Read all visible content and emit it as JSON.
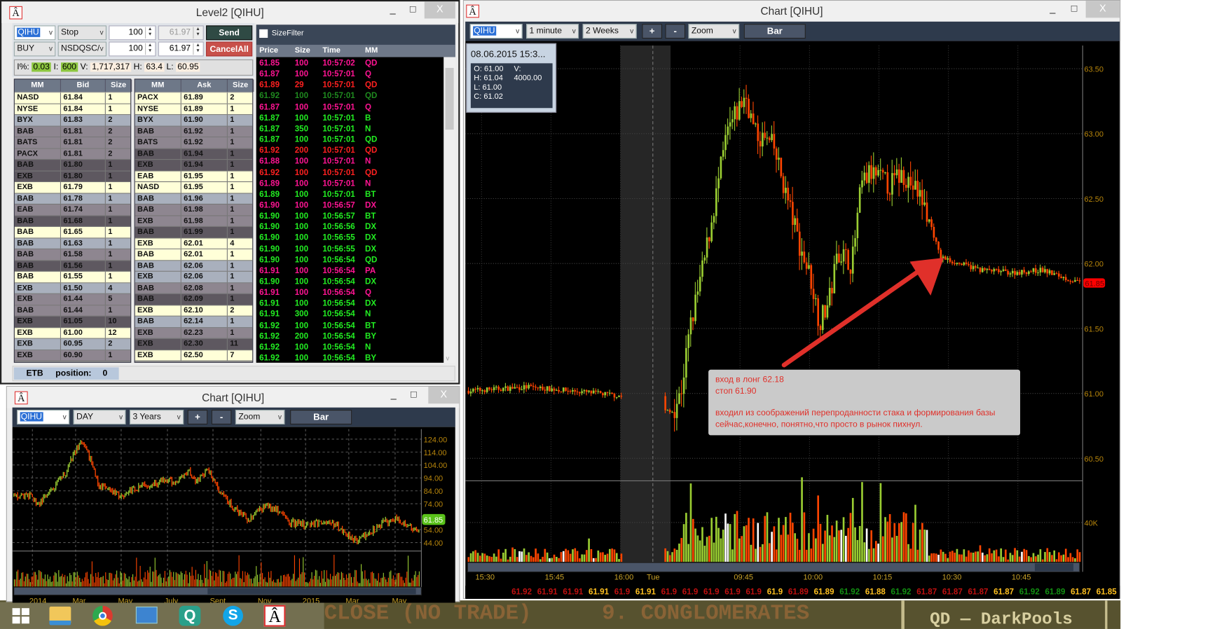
{
  "level2": {
    "title": "Level2 [QIHU]",
    "symbol": "QIHU",
    "order_type": "Stop",
    "side": "BUY",
    "route": "NSDQSC/",
    "qty1": "100",
    "qty2": "100",
    "price1": "61.97",
    "price2": "61.97",
    "send_label": "Send",
    "cancel_all_label": "CancelAll",
    "stats": {
      "i_pct_label": "I%:",
      "i_pct": "0.03",
      "i_label": "I:",
      "i": "600",
      "v_label": "V:",
      "v": "1,717,317",
      "h_label": "H:",
      "h": "63.4",
      "l_label": "L:",
      "l": "60.95"
    },
    "bid_headers": [
      "MM",
      "Bid",
      "Size"
    ],
    "ask_headers": [
      "MM",
      "Ask",
      "Size"
    ],
    "bids": [
      [
        "NASD",
        "61.84",
        "1",
        "y"
      ],
      [
        "NYSE",
        "61.84",
        "1",
        "y"
      ],
      [
        "BYX",
        "61.83",
        "2",
        "b"
      ],
      [
        "BAB",
        "61.81",
        "2",
        "m"
      ],
      [
        "BATS",
        "61.81",
        "2",
        "m"
      ],
      [
        "PACX",
        "61.81",
        "2",
        "m"
      ],
      [
        "BAB",
        "61.80",
        "1",
        "d"
      ],
      [
        "EXB",
        "61.80",
        "1",
        "d"
      ],
      [
        "EXB",
        "61.79",
        "1",
        "y"
      ],
      [
        "BAB",
        "61.78",
        "1",
        "b"
      ],
      [
        "EAB",
        "61.74",
        "1",
        "m"
      ],
      [
        "BAB",
        "61.68",
        "1",
        "d"
      ],
      [
        "BAB",
        "61.65",
        "1",
        "y"
      ],
      [
        "BAB",
        "61.63",
        "1",
        "b"
      ],
      [
        "BAB",
        "61.58",
        "1",
        "m"
      ],
      [
        "BAB",
        "61.56",
        "1",
        "d"
      ],
      [
        "BAB",
        "61.55",
        "1",
        "y"
      ],
      [
        "EXB",
        "61.50",
        "4",
        "b"
      ],
      [
        "EXB",
        "61.44",
        "5",
        "m"
      ],
      [
        "BAB",
        "61.44",
        "1",
        "m"
      ],
      [
        "EXB",
        "61.05",
        "10",
        "d"
      ],
      [
        "EXB",
        "61.00",
        "12",
        "y"
      ],
      [
        "EXB",
        "60.95",
        "2",
        "b"
      ],
      [
        "EXB",
        "60.90",
        "1",
        "m"
      ]
    ],
    "asks": [
      [
        "PACX",
        "61.89",
        "2",
        "y"
      ],
      [
        "NYSE",
        "61.89",
        "1",
        "y"
      ],
      [
        "BYX",
        "61.90",
        "1",
        "b"
      ],
      [
        "BAB",
        "61.92",
        "1",
        "m"
      ],
      [
        "BATS",
        "61.92",
        "1",
        "m"
      ],
      [
        "BAB",
        "61.94",
        "1",
        "d"
      ],
      [
        "EXB",
        "61.94",
        "1",
        "d"
      ],
      [
        "EAB",
        "61.95",
        "1",
        "y"
      ],
      [
        "NASD",
        "61.95",
        "1",
        "y"
      ],
      [
        "BAB",
        "61.96",
        "1",
        "b"
      ],
      [
        "BAB",
        "61.98",
        "1",
        "m"
      ],
      [
        "EXB",
        "61.98",
        "1",
        "m"
      ],
      [
        "BAB",
        "61.99",
        "1",
        "d"
      ],
      [
        "EXB",
        "62.01",
        "4",
        "y"
      ],
      [
        "BAB",
        "62.01",
        "1",
        "y"
      ],
      [
        "BAB",
        "62.06",
        "1",
        "b"
      ],
      [
        "EXB",
        "62.06",
        "1",
        "b"
      ],
      [
        "BAB",
        "62.08",
        "1",
        "m"
      ],
      [
        "BAB",
        "62.09",
        "1",
        "d"
      ],
      [
        "EXB",
        "62.10",
        "2",
        "y"
      ],
      [
        "BAB",
        "62.14",
        "1",
        "b"
      ],
      [
        "EXB",
        "62.23",
        "1",
        "m"
      ],
      [
        "EXB",
        "62.30",
        "11",
        "d"
      ],
      [
        "EXB",
        "62.50",
        "7",
        "y"
      ]
    ],
    "size_filter_label": "SizeFilter",
    "ts_headers": [
      "Price",
      "Size",
      "Time",
      "MM"
    ],
    "time_sales": [
      [
        "61.85",
        "100",
        "10:57:02",
        "QD",
        "p"
      ],
      [
        "61.87",
        "100",
        "10:57:01",
        "Q",
        "p"
      ],
      [
        "61.89",
        "29",
        "10:57:01",
        "QD",
        "r"
      ],
      [
        "61.92",
        "100",
        "10:57:01",
        "QD",
        "dg"
      ],
      [
        "61.87",
        "100",
        "10:57:01",
        "Q",
        "p"
      ],
      [
        "61.87",
        "100",
        "10:57:01",
        "B",
        "g"
      ],
      [
        "61.87",
        "350",
        "10:57:01",
        "N",
        "g"
      ],
      [
        "61.87",
        "100",
        "10:57:01",
        "QD",
        "g"
      ],
      [
        "61.92",
        "200",
        "10:57:01",
        "QD",
        "r"
      ],
      [
        "61.88",
        "100",
        "10:57:01",
        "N",
        "p"
      ],
      [
        "61.92",
        "100",
        "10:57:01",
        "QD",
        "r"
      ],
      [
        "61.89",
        "100",
        "10:57:01",
        "N",
        "p"
      ],
      [
        "61.89",
        "100",
        "10:57:01",
        "BT",
        "g"
      ],
      [
        "61.90",
        "100",
        "10:56:57",
        "DX",
        "p"
      ],
      [
        "61.90",
        "100",
        "10:56:57",
        "BT",
        "g"
      ],
      [
        "61.90",
        "100",
        "10:56:56",
        "DX",
        "g"
      ],
      [
        "61.90",
        "100",
        "10:56:55",
        "DX",
        "g"
      ],
      [
        "61.90",
        "100",
        "10:56:55",
        "DX",
        "g"
      ],
      [
        "61.90",
        "100",
        "10:56:54",
        "QD",
        "g"
      ],
      [
        "61.91",
        "100",
        "10:56:54",
        "PA",
        "p"
      ],
      [
        "61.90",
        "100",
        "10:56:54",
        "DX",
        "g"
      ],
      [
        "61.91",
        "100",
        "10:56:54",
        "Q",
        "p"
      ],
      [
        "61.91",
        "100",
        "10:56:54",
        "DX",
        "g"
      ],
      [
        "61.91",
        "300",
        "10:56:54",
        "N",
        "g"
      ],
      [
        "61.92",
        "100",
        "10:56:54",
        "BT",
        "g"
      ],
      [
        "61.92",
        "200",
        "10:56:54",
        "BY",
        "g"
      ],
      [
        "61.92",
        "100",
        "10:56:54",
        "N",
        "g"
      ],
      [
        "61.92",
        "100",
        "10:56:54",
        "BY",
        "g"
      ]
    ],
    "footer": {
      "etb": "ETB",
      "position_label": "position:",
      "position": "0"
    }
  },
  "daily_chart": {
    "title": "Chart [QIHU]",
    "symbol": "QIHU",
    "interval": "DAY",
    "range": "3 Years",
    "plus": "+",
    "minus": "-",
    "zoom": "Zoom",
    "bar": "Bar",
    "y_ticks": [
      "124.00",
      "114.00",
      "104.00",
      "94.00",
      "84.00",
      "74.00",
      "54.00",
      "44.00"
    ],
    "last_price": "61.85",
    "x_labels": [
      "2014",
      "Mar",
      "May",
      "July",
      "Sept",
      "Nov",
      "2015",
      "Mar",
      "May"
    ],
    "price_path_by_month": [
      [
        0,
        80
      ],
      [
        0.4,
        74
      ],
      [
        1,
        84
      ],
      [
        1.6,
        98
      ],
      [
        2.1,
        118
      ],
      [
        2.3,
        121
      ],
      [
        2.7,
        108
      ],
      [
        3,
        90
      ],
      [
        3.5,
        84
      ],
      [
        4,
        80
      ],
      [
        4.4,
        84
      ],
      [
        5,
        88
      ],
      [
        6,
        92
      ],
      [
        6.4,
        90
      ],
      [
        7,
        100
      ],
      [
        7.3,
        92
      ],
      [
        7.9,
        100
      ],
      [
        8.3,
        84
      ],
      [
        9,
        70
      ],
      [
        9.6,
        62
      ],
      [
        10.3,
        72
      ],
      [
        10.9,
        70
      ],
      [
        11.4,
        60
      ],
      [
        12,
        58
      ],
      [
        13,
        60
      ],
      [
        13.4,
        58
      ],
      [
        14,
        50
      ],
      [
        14.4,
        46
      ],
      [
        15,
        52
      ],
      [
        15.6,
        60
      ],
      [
        16.2,
        62
      ],
      [
        16.8,
        55
      ],
      [
        17.1,
        52
      ],
      [
        17.3,
        62
      ]
    ]
  },
  "intraday_chart": {
    "title": "Chart [QIHU]",
    "symbol": "QIHU",
    "interval": "1 minute",
    "range": "2 Weeks",
    "plus": "+",
    "minus": "-",
    "zoom": "Zoom",
    "bar": "Bar",
    "tooltip": {
      "date": "08.06.2015 15:3...",
      "o": "O: 61.00",
      "h": "H: 61.04",
      "l": "L: 61.00",
      "c": "C: 61.02",
      "v_label": "V:",
      "v": "4000.00"
    },
    "y_ticks": [
      "63.50",
      "63.00",
      "62.50",
      "62.00",
      "61.50",
      "61.00",
      "60.50"
    ],
    "volume_tick": "40K",
    "last_price": "61.85",
    "x_labels": [
      "15:30",
      "15:45",
      "16:00",
      "Tue",
      "09:45",
      "10:00",
      "10:15",
      "10:30",
      "10:45"
    ],
    "price_path": [
      [
        "15:27",
        61.02
      ],
      [
        "15:40",
        61.05
      ],
      [
        "15:55",
        61.0
      ],
      [
        "16:00",
        60.98
      ],
      [
        "09:30",
        60.85
      ],
      [
        "09:32",
        61.0
      ],
      [
        "09:34",
        61.5
      ],
      [
        "09:37",
        62.0
      ],
      [
        "09:40",
        62.6
      ],
      [
        "09:42",
        63.0
      ],
      [
        "09:46",
        63.3
      ],
      [
        "09:48",
        63.0
      ],
      [
        "09:52",
        62.9
      ],
      [
        "09:55",
        62.5
      ],
      [
        "09:58",
        62.1
      ],
      [
        "10:00",
        61.9
      ],
      [
        "10:02",
        61.55
      ],
      [
        "10:04",
        61.7
      ],
      [
        "10:06",
        62.1
      ],
      [
        "10:09",
        62.0
      ],
      [
        "10:11",
        62.6
      ],
      [
        "10:13",
        62.7
      ],
      [
        "10:17",
        62.6
      ],
      [
        "10:20",
        62.7
      ],
      [
        "10:24",
        62.5
      ],
      [
        "10:26",
        62.3
      ],
      [
        "10:28",
        62.05
      ],
      [
        "10:32",
        62.0
      ],
      [
        "10:37",
        61.95
      ],
      [
        "10:44",
        61.93
      ],
      [
        "10:50",
        61.95
      ],
      [
        "10:58",
        61.85
      ]
    ],
    "note": {
      "line1": "вход в лонг 62.18",
      "line2": "стоп 61.90",
      "line3": "входил из соображений перепроданности стака и формирования базы",
      "line4": "сейчас,конечно, понятно,что просто в рынок пихнул."
    },
    "ticker": [
      [
        "61.92",
        "r"
      ],
      [
        "61.91",
        "r"
      ],
      [
        "61.91",
        "r"
      ],
      [
        "61.91",
        "y"
      ],
      [
        "61.9",
        "r"
      ],
      [
        "61.91",
        "y"
      ],
      [
        "61.9",
        "r"
      ],
      [
        "61.9",
        "r"
      ],
      [
        "61.9",
        "r"
      ],
      [
        "61.9",
        "r"
      ],
      [
        "61.9",
        "r"
      ],
      [
        "61.9",
        "y"
      ],
      [
        "61.89",
        "r"
      ],
      [
        "61.89",
        "y"
      ],
      [
        "61.92",
        "g"
      ],
      [
        "61.88",
        "y"
      ],
      [
        "61.92",
        "g"
      ],
      [
        "61.87",
        "r"
      ],
      [
        "61.87",
        "r"
      ],
      [
        "61.87",
        "r"
      ],
      [
        "61.87",
        "y"
      ],
      [
        "61.92",
        "g"
      ],
      [
        "61.89",
        "g"
      ],
      [
        "61.87",
        "y"
      ],
      [
        "61.85",
        "y"
      ]
    ]
  },
  "background": {
    "text1": "CLOSE (NO TRADE)",
    "text2": "9. CONGLOMERATES",
    "text3": "QD — DarkPools"
  },
  "taskbar": {
    "icons": [
      "windows-start",
      "file-explorer",
      "chrome",
      "control-panel",
      "q-app",
      "skype",
      "trading-app"
    ]
  },
  "colors": {
    "up": "#9acd32",
    "down": "#ff4500",
    "pink": "#ff1493",
    "red": "#ff2020",
    "green": "#22ee22",
    "darkgreen": "#1f8a1f",
    "ticker_yellow": "#ffc020",
    "ticker_red": "#c01010",
    "ticker_green": "#129012"
  }
}
